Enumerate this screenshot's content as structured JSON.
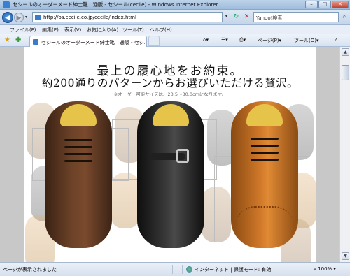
{
  "window": {
    "title": "セシールのオーダーメード紳士靴　通販 - セシール(cecile) - Windows Internet Explorer",
    "min_glyph": "–",
    "max_glyph": "□",
    "close_glyph": "✕"
  },
  "address": {
    "url": "http://os.cecile.co.jp/cecile/index.html",
    "search_placeholder": "Yahoo!検索",
    "back_glyph": "◀",
    "forward_glyph": "▶",
    "refresh_glyph": "↻",
    "stop_glyph": "✕",
    "search_glyph": "⌕"
  },
  "menu": {
    "items": [
      "ファイル(F)",
      "編集(E)",
      "表示(V)",
      "お気に入り(A)",
      "ツール(T)",
      "ヘルプ(H)"
    ]
  },
  "tabs": {
    "active_title": "セシールのオーダーメード紳士靴　通販 - セシ..."
  },
  "commandbar": {
    "page_label": "ページ(P)",
    "tools_label": "ツール(O)",
    "help_glyph": "?"
  },
  "page": {
    "headline1": "最上の履心地をお約束。",
    "headline2": "約200通りのパターンからお選びいただける贅沢。",
    "size_note": "※オーダー可能サイズは、23.5〜30.0cmになります。"
  },
  "statusbar": {
    "status": "ページが表示されました",
    "zone": "インターネット | 保護モード: 有効",
    "zoom": "100%"
  },
  "colors": {
    "shoe_brown": "#6c4228",
    "shoe_black": "#2a2a2a",
    "shoe_tan": "#d27a2a"
  }
}
